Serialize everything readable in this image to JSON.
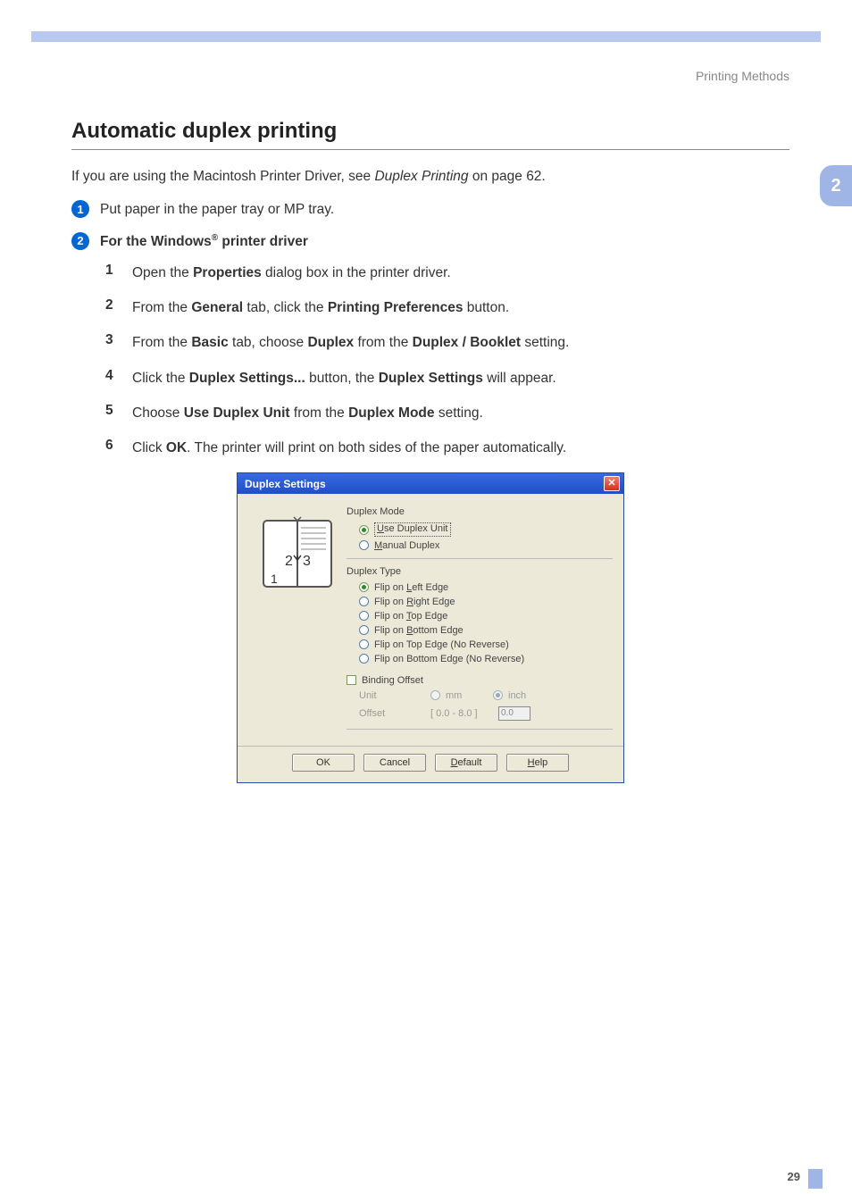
{
  "header": {
    "section": "Printing Methods"
  },
  "title": "Automatic duplex printing",
  "intro": {
    "pre": "If you are using the Macintosh Printer Driver, see ",
    "link": "Duplex Printing",
    "post": " on page 62."
  },
  "side_tab": "2",
  "steps": [
    {
      "text_plain": "Put paper in the paper tray or MP tray."
    },
    {
      "prefix": "For the Windows",
      "reg": "®",
      "suffix": " printer driver"
    }
  ],
  "substeps": [
    {
      "n": "1",
      "parts": [
        "Open the ",
        "Properties",
        " dialog box in the printer driver."
      ]
    },
    {
      "n": "2",
      "parts": [
        "From the ",
        "General",
        " tab, click the ",
        "Printing Preferences",
        " button."
      ]
    },
    {
      "n": "3",
      "parts": [
        "From the ",
        "Basic",
        " tab, choose ",
        "Duplex",
        " from the ",
        "Duplex / Booklet",
        " setting."
      ]
    },
    {
      "n": "4",
      "parts": [
        "Click the ",
        "Duplex Settings...",
        " button, the ",
        "Duplex Settings",
        " will appear."
      ]
    },
    {
      "n": "5",
      "parts": [
        "Choose ",
        "Use Duplex Unit",
        " from the ",
        "Duplex Mode",
        " setting."
      ]
    },
    {
      "n": "6",
      "parts": [
        "Click ",
        "OK",
        ". The printer will print on both sides of the paper automatically."
      ]
    }
  ],
  "dialog": {
    "title": "Duplex Settings",
    "mode_label": "Duplex Mode",
    "mode_options": [
      {
        "pre": "",
        "u": "U",
        "post": "se Duplex Unit",
        "selected": true
      },
      {
        "pre": "",
        "u": "M",
        "post": "anual Duplex",
        "selected": false
      }
    ],
    "type_label": "Duplex Type",
    "type_options": [
      {
        "pre": "Flip on ",
        "u": "L",
        "post": "eft Edge",
        "selected": true
      },
      {
        "pre": "Flip on ",
        "u": "R",
        "post": "ight Edge",
        "selected": false
      },
      {
        "pre": "Flip on ",
        "u": "T",
        "post": "op Edge",
        "selected": false
      },
      {
        "pre": "Flip on ",
        "u": "B",
        "post": "ottom Edge",
        "selected": false
      },
      {
        "pre": "Flip on Top Edge (No Reverse)",
        "u": "",
        "post": "",
        "selected": false
      },
      {
        "pre": "Flip on Bottom Edge (No Reverse)",
        "u": "",
        "post": "",
        "selected": false
      }
    ],
    "binding_offset_label": {
      "pre": "Binding ",
      "u": "O",
      "post": "ffset"
    },
    "unit_label": "Unit",
    "unit_mm": "mm",
    "unit_inch": "inch",
    "offset_label": "Offset",
    "offset_range": "[ 0.0 - 8.0 ]",
    "offset_value": "0.0",
    "buttons": {
      "ok": "OK",
      "cancel": "Cancel",
      "default": {
        "u": "D",
        "post": "efault"
      },
      "help": {
        "u": "H",
        "post": "elp"
      }
    }
  },
  "page_number": "29"
}
